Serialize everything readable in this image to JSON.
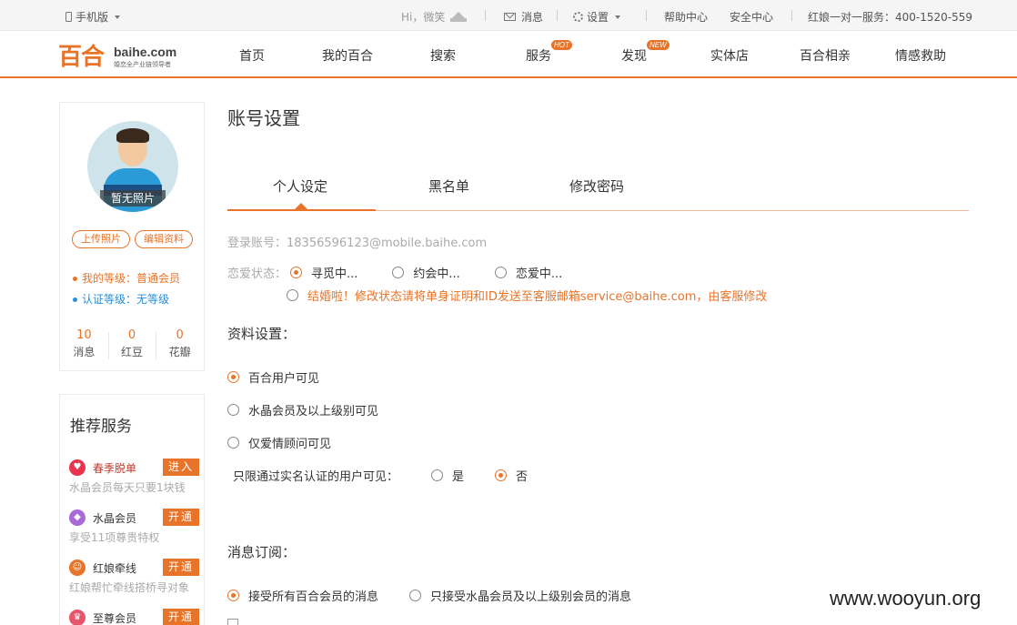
{
  "topbar": {
    "mobile_label": "手机版",
    "greeting": "Hi，微笑",
    "messages_label": "消息",
    "settings_label": "设置",
    "help_label": "帮助中心",
    "safety_label": "安全中心",
    "hotline": "红娘一对一服务：400-1520-559"
  },
  "logo": {
    "cn": "百合",
    "en": "baihe.com",
    "slogan": "婚恋全产业链领导者"
  },
  "nav": {
    "items": [
      {
        "label": "首页"
      },
      {
        "label": "我的百合"
      },
      {
        "label": "搜索"
      },
      {
        "label": "服务",
        "badge": "HOT"
      },
      {
        "label": "发现",
        "badge": "NEW"
      },
      {
        "label": "实体店"
      },
      {
        "label": "百合相亲"
      },
      {
        "label": "情感救助"
      }
    ]
  },
  "profile": {
    "no_photo": "暂无照片",
    "upload_photo": "上传照片",
    "edit_profile": "编辑资料",
    "my_level": "我的等级：普通会员",
    "verify_level": "认证等级：无等级",
    "level_dot_color": "#e8742a",
    "verify_dot_color": "#2a8fd6",
    "stats": [
      {
        "value": "10",
        "label": "消息"
      },
      {
        "value": "0",
        "label": "红豆"
      },
      {
        "value": "0",
        "label": "花瓣"
      }
    ]
  },
  "recommend": {
    "title": "推荐服务",
    "services": [
      {
        "name": "春季脱单",
        "button": "进入",
        "desc": "水晶会员每天只要1块钱",
        "icon": "heart-icon",
        "color": "#e8344e",
        "name_color": "#c0392b"
      },
      {
        "name": "水晶会员",
        "button": "开通",
        "desc": "享受11项尊贵特权",
        "icon": "diamond-icon",
        "color": "#a86ad6",
        "name_color": "#333333"
      },
      {
        "name": "红娘牵线",
        "button": "开通",
        "desc": "红娘帮忙牵线搭桥寻对象",
        "icon": "matchmaker-icon",
        "color": "#e8742a",
        "name_color": "#333333"
      },
      {
        "name": "至尊会员",
        "button": "开通",
        "desc": "",
        "icon": "crown-icon",
        "color": "#e8556a",
        "name_color": "#333333"
      }
    ]
  },
  "main": {
    "title": "账号设置",
    "tabs": [
      {
        "label": "个人设定",
        "active": true
      },
      {
        "label": "黑名单",
        "active": false
      },
      {
        "label": "修改密码",
        "active": false
      }
    ],
    "login_account": "登录账号：18356596123@mobile.baihe.com",
    "relationship": {
      "label": "恋爱状态：",
      "options": [
        "寻觅中...",
        "约会中...",
        "恋爱中..."
      ],
      "selected": 0,
      "married_note": "结婚啦！修改状态请将单身证明和ID发送至客服邮箱service@baihe.com，由客服修改"
    },
    "profile_settings": {
      "title": "资料设置：",
      "options": [
        "百合用户可见",
        "水晶会员及以上级别可见",
        "仅爱情顾问可见"
      ],
      "selected": 0,
      "verified_only_label": "只限通过实名认证的用户可见：",
      "yes": "是",
      "no": "否",
      "verified_only_selected": "no"
    },
    "subscription": {
      "title": "消息订阅：",
      "options": [
        "接受所有百合会员的消息",
        "只接受水晶会员及以上级别会员的消息"
      ],
      "selected": 0
    }
  },
  "watermark": "www.wooyun.org"
}
